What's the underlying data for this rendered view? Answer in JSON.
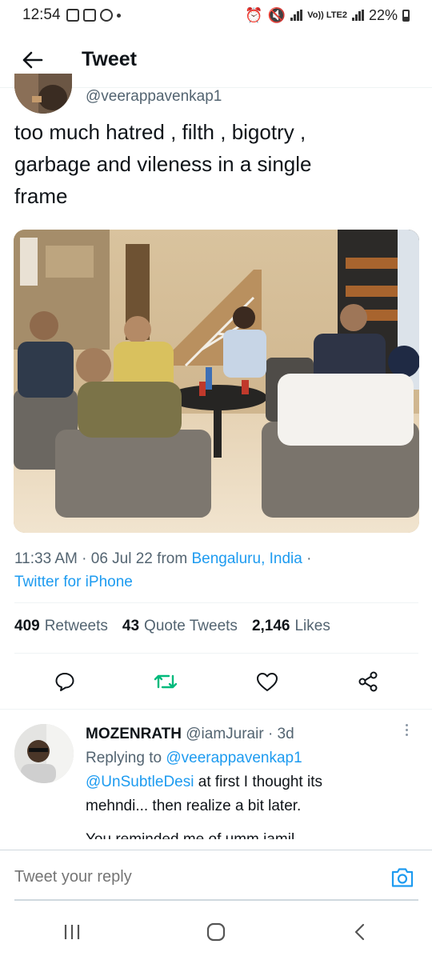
{
  "status_bar": {
    "time": "12:54",
    "network": "Vo)) LTE2",
    "battery": "22%"
  },
  "header": {
    "title": "Tweet"
  },
  "tweet": {
    "handle": "@veerappavenkap1",
    "text": "too much hatred , filth , bigotry ,\ngarbage and vileness in a single\nframe",
    "time": "11:33 AM",
    "date": "06 Jul 22",
    "from_label": "from",
    "location": "Bengaluru, India",
    "client": "Twitter for iPhone",
    "stats": {
      "retweets_count": "409",
      "retweets_label": "Retweets",
      "quotes_count": "43",
      "quotes_label": "Quote Tweets",
      "likes_count": "2,146",
      "likes_label": "Likes"
    }
  },
  "reply": {
    "name": "MOZENRATH",
    "handle": "@iamJurair",
    "age": "· 3d",
    "replying_label": "Replying to",
    "replying_to": "@veerappavenkap1",
    "mention": "@UnSubtleDesi",
    "text_line1": " at first I thought its",
    "text_line2": "mehndi... then realize a bit later.",
    "text_cut": "You reminded me of umm jamil"
  },
  "composer": {
    "placeholder": "Tweet your reply"
  },
  "colors": {
    "accent": "#1d9bf0",
    "retweet": "#00ba7c",
    "secondary_text": "#536471"
  }
}
